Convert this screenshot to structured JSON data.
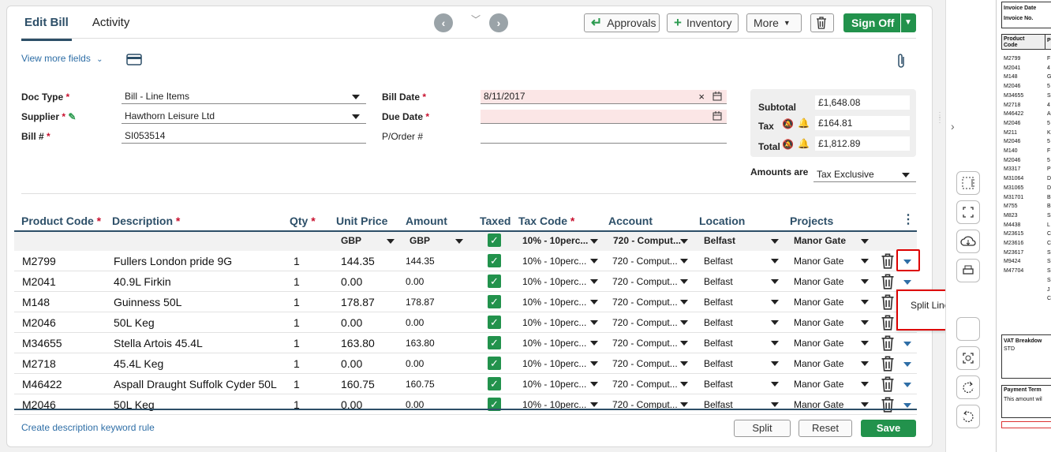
{
  "tabs": {
    "edit_bill": "Edit Bill",
    "activity": "Activity"
  },
  "toolbar": {
    "approvals": "Approvals",
    "inventory": "Inventory",
    "more": "More",
    "sign_off": "Sign Off"
  },
  "view_more_fields": "View more fields",
  "form": {
    "doc_type_label": "Doc Type",
    "doc_type_value": "Bill - Line Items",
    "supplier_label": "Supplier",
    "supplier_value": "Hawthorn Leisure Ltd",
    "bill_no_label": "Bill #",
    "bill_no_value": "SI053514",
    "bill_date_label": "Bill Date",
    "bill_date_value": "8/11/2017",
    "due_date_label": "Due Date",
    "due_date_value": "",
    "porder_label": "P/Order #",
    "porder_value": ""
  },
  "totals": {
    "subtotal_label": "Subtotal",
    "subtotal": "£1,648.08",
    "tax_label": "Tax",
    "tax": "£164.81",
    "total_label": "Total",
    "total": "£1,812.89",
    "amounts_are_label": "Amounts are",
    "amounts_are": "Tax Exclusive"
  },
  "columns": {
    "product_code": "Product Code",
    "description": "Description",
    "qty": "Qty",
    "unit_price": "Unit Price",
    "amount": "Amount",
    "taxed": "Taxed",
    "tax_code": "Tax Code",
    "account": "Account",
    "location": "Location",
    "projects": "Projects"
  },
  "defaults": {
    "unit_price": "GBP",
    "amount": "GBP",
    "tax_code": "10% - 10perc...",
    "account": "720 - Comput...",
    "location": "Belfast",
    "projects": "Manor Gate"
  },
  "rows": [
    {
      "code": "M2799",
      "desc": "Fullers London pride 9G",
      "qty": "1",
      "unit": "144.35",
      "amount": "144.35",
      "tax": "10% - 10perc...",
      "account": "720 - Comput...",
      "location": "Belfast",
      "project": "Manor Gate"
    },
    {
      "code": "M2041",
      "desc": "40.9L Firkin",
      "qty": "1",
      "unit": "0.00",
      "amount": "0.00",
      "tax": "10% - 10perc...",
      "account": "720 - Comput...",
      "location": "Belfast",
      "project": "Manor Gate"
    },
    {
      "code": "M148",
      "desc": "Guinness  50L",
      "qty": "1",
      "unit": "178.87",
      "amount": "178.87",
      "tax": "10% - 10perc...",
      "account": "720 - Comput...",
      "location": "Belfast",
      "project": "Manor Gate"
    },
    {
      "code": "M2046",
      "desc": "50L Keg",
      "qty": "1",
      "unit": "0.00",
      "amount": "0.00",
      "tax": "10% - 10perc...",
      "account": "720 - Comput...",
      "location": "Belfast",
      "project": "Manor Gate"
    },
    {
      "code": "M34655",
      "desc": "Stella Artois  45.4L",
      "qty": "1",
      "unit": "163.80",
      "amount": "163.80",
      "tax": "10% - 10perc...",
      "account": "720 - Comput...",
      "location": "Belfast",
      "project": "Manor Gate"
    },
    {
      "code": "M2718",
      "desc": "45.4L Keg",
      "qty": "1",
      "unit": "0.00",
      "amount": "0.00",
      "tax": "10% - 10perc...",
      "account": "720 - Comput...",
      "location": "Belfast",
      "project": "Manor Gate"
    },
    {
      "code": "M46422",
      "desc": "Aspall Draught Suffolk Cyder 50L",
      "qty": "1",
      "unit": "160.75",
      "amount": "160.75",
      "tax": "10% - 10perc...",
      "account": "720 - Comput...",
      "location": "Belfast",
      "project": "Manor Gate"
    },
    {
      "code": "M2046",
      "desc": "50L Keg",
      "qty": "1",
      "unit": "0.00",
      "amount": "0.00",
      "tax": "10% - 10perc...",
      "account": "720 - Comput...",
      "location": "Belfast",
      "project": "Manor Gate"
    }
  ],
  "popup": "Split Line Item Amount",
  "footer": {
    "keyword_rule": "Create description keyword rule",
    "split": "Split",
    "reset": "Reset",
    "save": "Save"
  },
  "document": {
    "invoice_date": "Invoice Date",
    "invoice_no": "Invoice No.",
    "product_code": "Product Code",
    "p": "P",
    "codes": [
      "M2799",
      "M2041",
      "M148",
      "M2046",
      "M34655",
      "M2718",
      "M46422",
      "M2046",
      "M211",
      "M2046",
      "M140",
      "M2046",
      "M3317",
      "M31064",
      "M31065",
      "M31701",
      "M755",
      "M823",
      "M4438",
      "M23615",
      "M23616",
      "M23617",
      "M9424",
      "M47704"
    ],
    "letters": [
      "F",
      "4",
      "G",
      "5",
      "S",
      "4",
      "A",
      "5",
      "K",
      "5",
      "F",
      "5",
      "P",
      "D",
      "D",
      "B",
      "B",
      "S",
      "L",
      "C",
      "C",
      "S",
      "S",
      "S",
      "S",
      "J",
      "C"
    ],
    "vat_breakdown": "VAT Breakdow",
    "std": "STD",
    "payment_terms": "Payment Term",
    "payment_text": "This amount wil"
  }
}
